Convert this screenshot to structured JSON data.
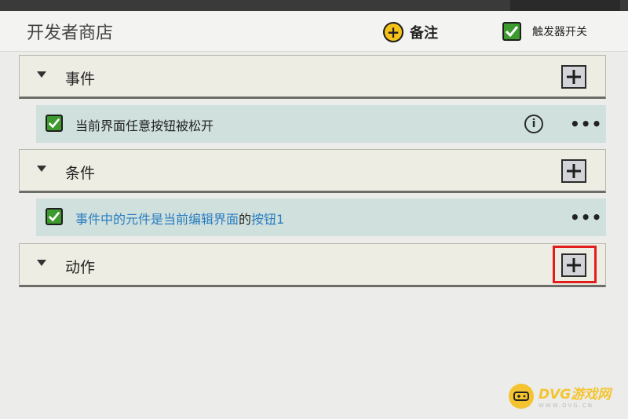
{
  "header": {
    "title": "开发者商店",
    "note_label": "备注",
    "trigger_label": "触发器开关"
  },
  "sections": {
    "event": {
      "label": "事件",
      "rows": [
        {
          "text": "当前界面任意按钮被松开"
        }
      ]
    },
    "condition": {
      "label": "条件",
      "rows": [
        {
          "text_part1": "事件中的元件是当前编辑界面",
          "text_part2": "的",
          "text_part3": "按钮1"
        }
      ]
    },
    "action": {
      "label": "动作"
    }
  },
  "watermark": {
    "main": "DVG游戏网",
    "sub": "WWW.DVG.CN"
  },
  "colors": {
    "accent_yellow": "#f5c21a",
    "check_green": "#3c9a2e",
    "row_bg": "#cfe0dd",
    "link_blue": "#2a7cc0",
    "highlight_red": "#e21d1d"
  }
}
